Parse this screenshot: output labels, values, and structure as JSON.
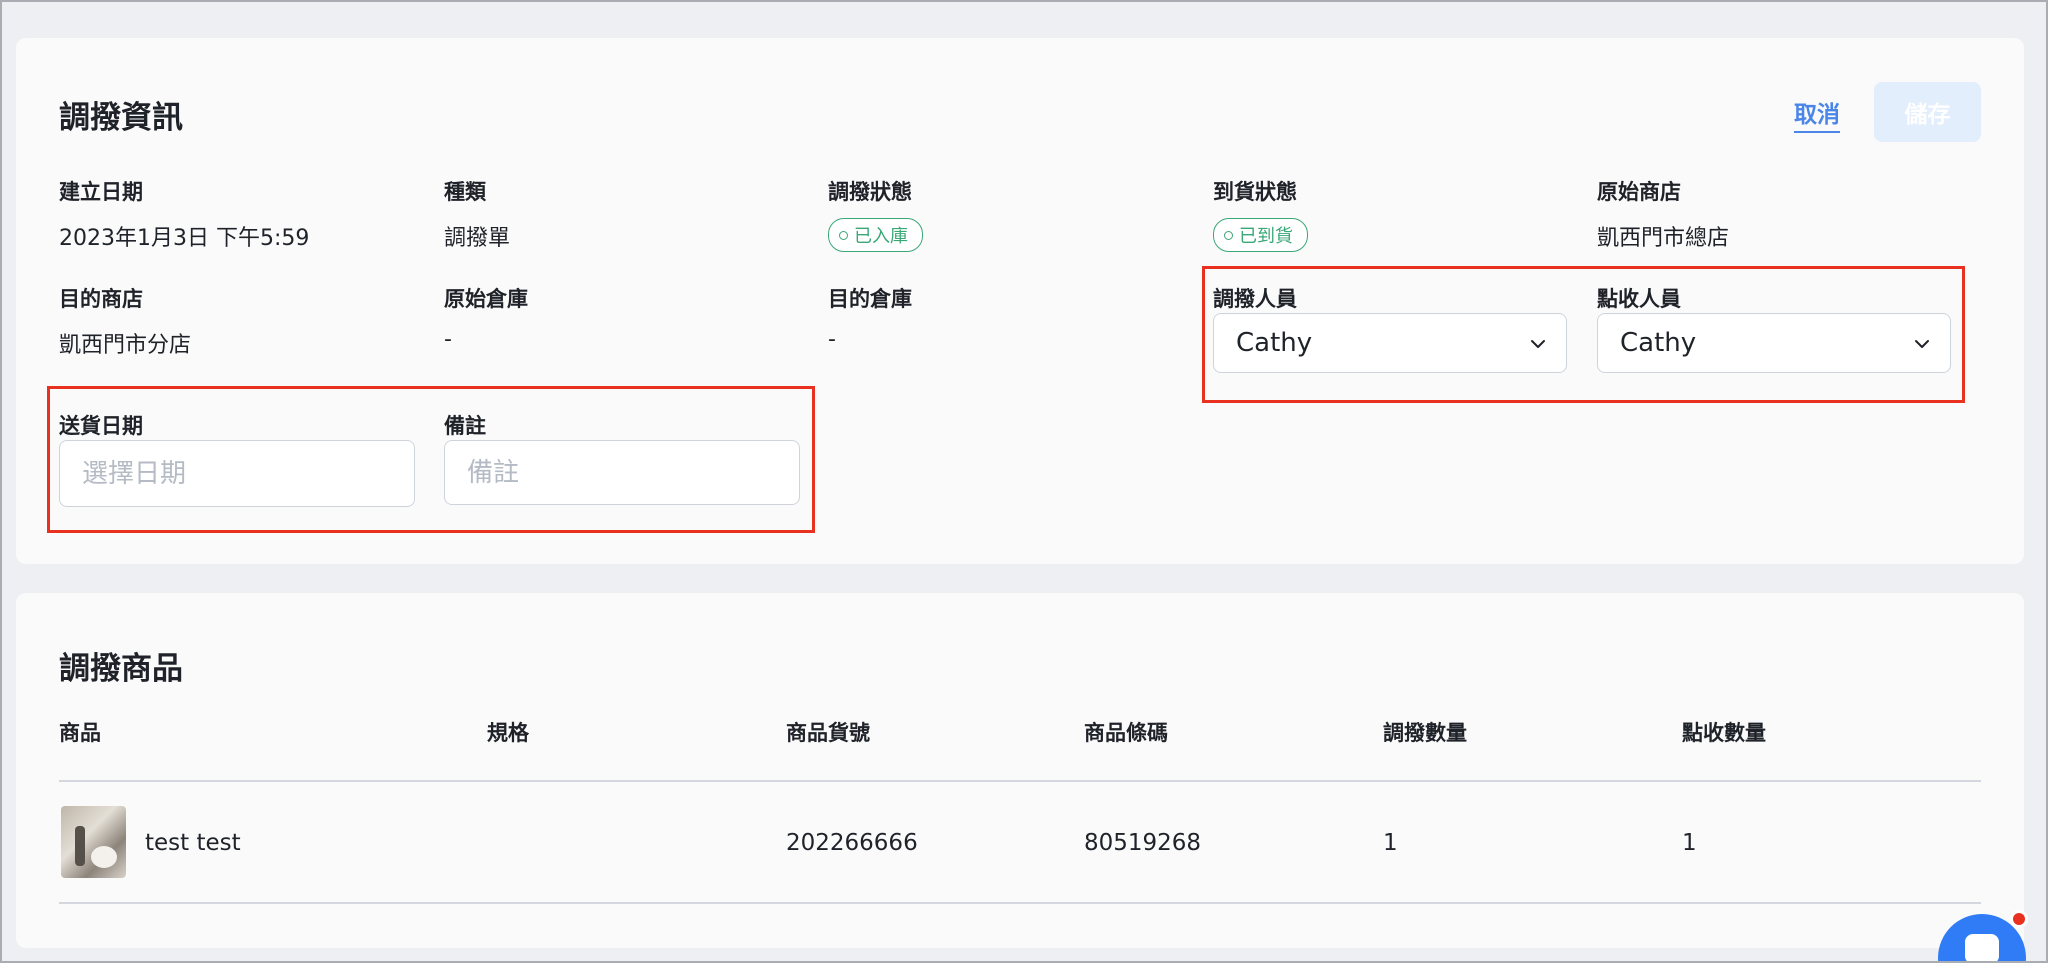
{
  "info": {
    "title": "調撥資訊",
    "cancel_label": "取消",
    "save_label": "儲存",
    "fields": {
      "created_date": {
        "label": "建立日期",
        "value": "2023年1月3日 下午5:59"
      },
      "type": {
        "label": "種類",
        "value": "調撥單"
      },
      "transfer_status": {
        "label": "調撥狀態",
        "value": "已入庫"
      },
      "arrival_status": {
        "label": "到貨狀態",
        "value": "已到貨"
      },
      "source_store": {
        "label": "原始商店",
        "value": "凱西門市總店"
      },
      "dest_store": {
        "label": "目的商店",
        "value": "凱西門市分店"
      },
      "source_warehouse": {
        "label": "原始倉庫",
        "value": "-"
      },
      "dest_warehouse": {
        "label": "目的倉庫",
        "value": "-"
      },
      "transfer_person": {
        "label": "調撥人員",
        "value": "Cathy"
      },
      "receive_person": {
        "label": "點收人員",
        "value": "Cathy"
      },
      "delivery_date": {
        "label": "送貨日期",
        "placeholder": "選擇日期"
      },
      "remark": {
        "label": "備註",
        "placeholder": "備註"
      }
    },
    "status_colors": {
      "success": "#3aa776"
    }
  },
  "products": {
    "title": "調撥商品",
    "columns": [
      "商品",
      "規格",
      "商品貨號",
      "商品條碼",
      "調撥數量",
      "點收數量"
    ],
    "rows": [
      {
        "name": "test test",
        "spec": "",
        "sku": "202266666",
        "barcode": "80519268",
        "transfer_qty": "1",
        "received_qty": "1"
      }
    ]
  },
  "theme": {
    "accent": "#4a86e8",
    "highlight": "#e8321f"
  }
}
